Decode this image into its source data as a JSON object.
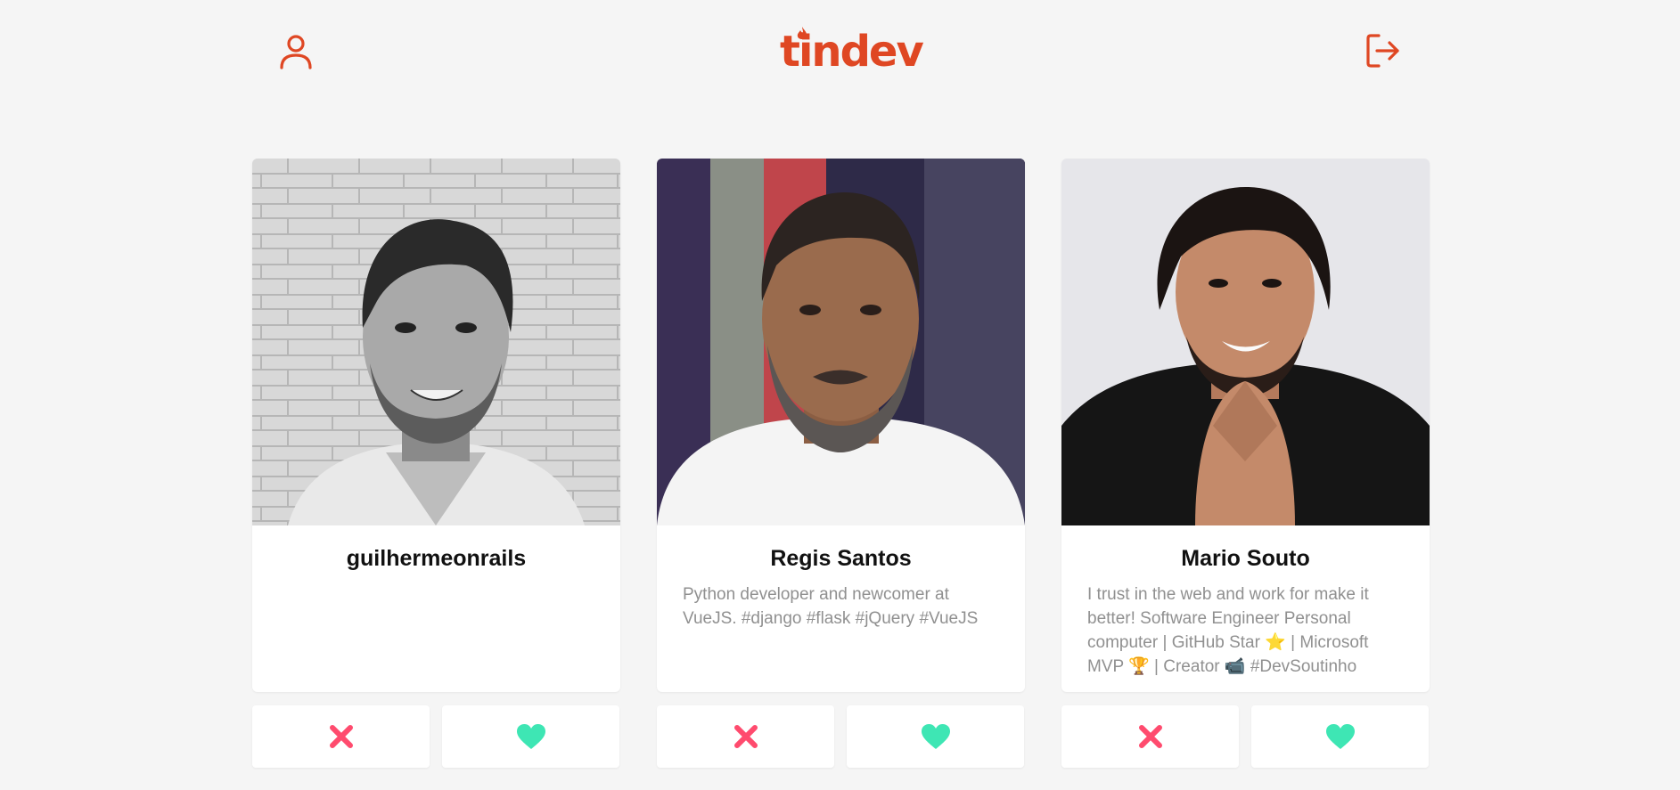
{
  "header": {
    "logo_text": "tindev",
    "profile_icon": "user-icon",
    "logout_icon": "logout-icon",
    "brand_color": "#df4723"
  },
  "developers": [
    {
      "name": "guilhermeonrails",
      "bio": "",
      "photo_style": "grayscale"
    },
    {
      "name": "Regis Santos",
      "bio": "Python developer and newcomer at VueJS. #django #flask #jQuery #VueJS",
      "photo_style": "color"
    },
    {
      "name": "Mario Souto",
      "bio": "I trust in the web and work for make it better! Software Engineer Personal computer | GitHub Star ⭐ | Microsoft MVP 🏆 | Creator 📹 #DevSoutinho",
      "photo_style": "color"
    }
  ],
  "actions": {
    "dislike_icon": "close-icon",
    "like_icon": "heart-icon",
    "dislike_color": "#ff4b6e",
    "like_color": "#3ee6b4"
  }
}
